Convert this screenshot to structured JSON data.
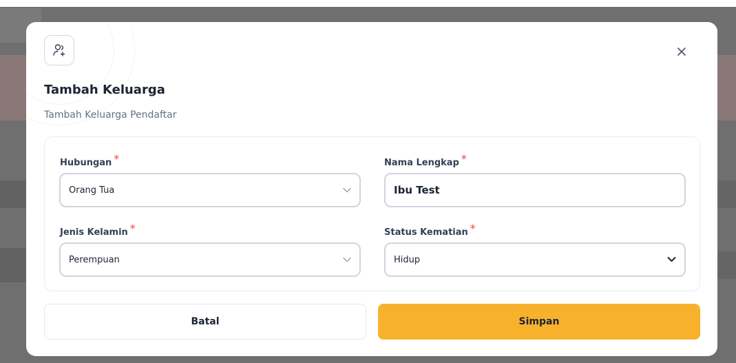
{
  "modal": {
    "title": "Tambah Keluarga",
    "subtitle": "Tambah Keluarga Pendaftar",
    "header_icon": "user-add-icon",
    "close_icon": "close-icon"
  },
  "form": {
    "required_mark": "*",
    "hubungan": {
      "label": "Hubungan",
      "value": "Orang Tua"
    },
    "nama_lengkap": {
      "label": "Nama Lengkap",
      "value": "Ibu Test"
    },
    "jenis_kelamin": {
      "label": "Jenis Kelamin",
      "value": "Perempuan"
    },
    "status_kematian": {
      "label": "Status Kematian",
      "value": "Hidup"
    }
  },
  "actions": {
    "cancel_label": "Batal",
    "save_label": "Simpan"
  },
  "colors": {
    "accent": "#f8b12c",
    "required": "#ef4444",
    "overlay": "#6f6f6f"
  }
}
